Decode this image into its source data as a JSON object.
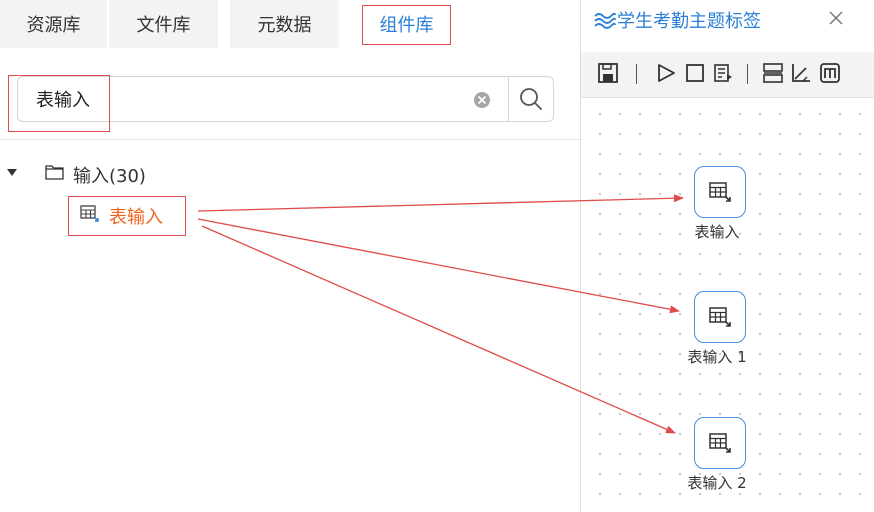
{
  "left_tabs": [
    {
      "label": "资源库",
      "active": false
    },
    {
      "label": "文件库",
      "active": false
    },
    {
      "label": "元数据",
      "active": false
    },
    {
      "label": "组件库",
      "active": true
    }
  ],
  "search": {
    "value": "表输入",
    "placeholder": ""
  },
  "tree": {
    "folder_label": "输入(30)",
    "item_label": "表输入"
  },
  "document_tab": {
    "title": "学生考勤主题标签"
  },
  "toolbar_icons": [
    "save-icon",
    "run-icon",
    "stop-icon",
    "preview-icon",
    "align-icon",
    "axis-icon",
    "fit-icon"
  ],
  "canvas_nodes": [
    {
      "label": "表输入"
    },
    {
      "label": "表输入 1"
    },
    {
      "label": "表输入 2"
    }
  ],
  "colors": {
    "accent": "#2b7fd9",
    "highlight_orange": "#f0641e",
    "annotation_red": "#e04b4b",
    "node_border": "#4a8fe0"
  }
}
